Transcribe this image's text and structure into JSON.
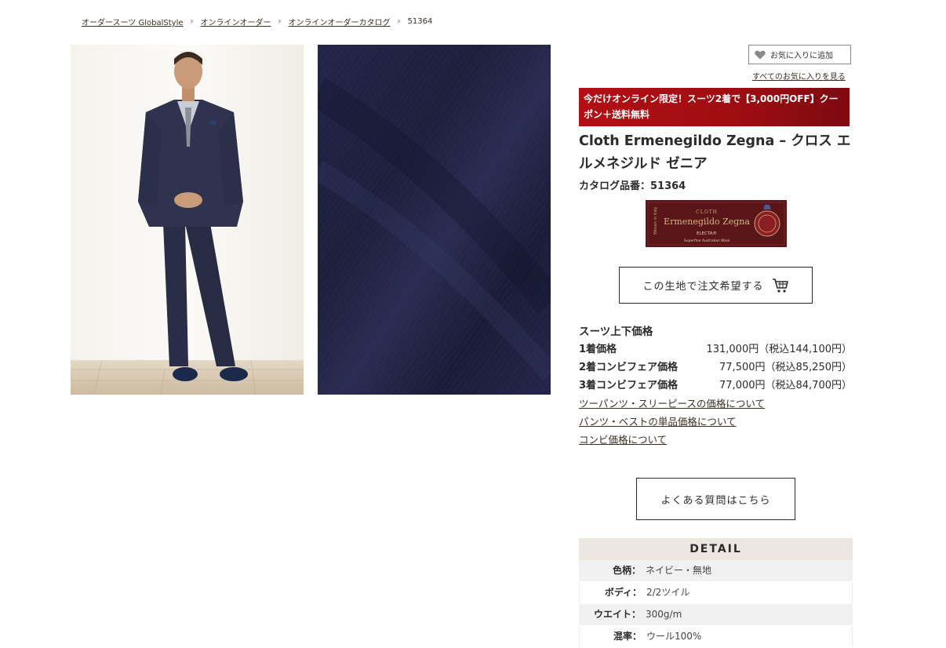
{
  "breadcrumb": {
    "items": [
      "オーダースーツ GlobalStyle",
      "オンラインオーダー",
      "オンラインオーダーカタログ"
    ],
    "separator": "›",
    "current": "51364"
  },
  "favorites": {
    "add_label": "お気に入りに追加",
    "view_all_label": "すべてのお気に入りを見る"
  },
  "promo": {
    "text": "今だけオンライン限定！スーツ2着で【3,000円OFF】クーポン＋送料無料"
  },
  "product": {
    "title": "Cloth Ermenegildo Zegna – クロス エルメネジルド ゼニア",
    "catalog_number": "カタログ品番：51364"
  },
  "brand_label": {
    "line1": "CLOTH",
    "line2": "Ermenegildo Zegna",
    "line3": "ELECTA®",
    "line4": "Superfine Australian Wool",
    "side_text": "Woven in Italy"
  },
  "order_button": {
    "label": "この生地で注文希望する",
    "icon": "cart-icon"
  },
  "pricing": {
    "heading": "スーツ上下価格",
    "rows": [
      {
        "label": "1着価格",
        "price": "131,000円（税込144,100円）"
      },
      {
        "label": "2着コンビフェア価格",
        "price": "77,500円（税込85,250円）"
      },
      {
        "label": "3着コンビフェア価格",
        "price": "77,000円（税込84,700円）"
      }
    ],
    "links": [
      "ツーパンツ・スリーピースの価格について",
      "パンツ・ベストの単品価格について",
      "コンビ価格について"
    ]
  },
  "faq_button": {
    "label": "よくある質問はこちら"
  },
  "detail": {
    "heading": "DETAIL",
    "rows": [
      {
        "key": "色柄：",
        "value": "ネイビー・無地"
      },
      {
        "key": "ボディ：",
        "value": "2/2ツイル"
      },
      {
        "key": "ウエイト：",
        "value": "300g/m"
      },
      {
        "key": "混率：",
        "value": "ウール100%"
      }
    ]
  },
  "colors": {
    "promo_red": "#b30f14",
    "fabric_navy": "#1f2140",
    "label_maroon": "#5a1518",
    "detail_header_bg": "#ebe6e0"
  }
}
